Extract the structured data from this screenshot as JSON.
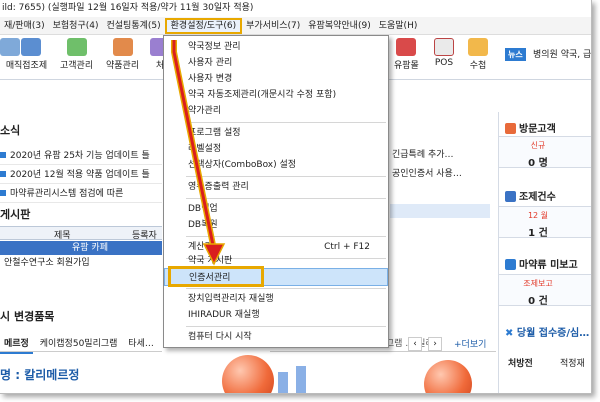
{
  "window": {
    "title": "ild: 7655) (실행파일 12월 16일자 적용/약가 11월 30일자 적용)"
  },
  "menubar": {
    "items": [
      {
        "label": "재/판매(3)"
      },
      {
        "label": "보험청구(4)"
      },
      {
        "label": "컨설팅통계(5)"
      },
      {
        "label": "환경설정/도구(6)"
      },
      {
        "label": "부가서비스(7)"
      },
      {
        "label": "유팜복약안내(9)"
      },
      {
        "label": "도움말(H)"
      }
    ]
  },
  "toolbar": {
    "left_tools": [
      "매",
      "직접조제",
      "고객관리",
      "약품관리",
      "처"
    ],
    "right_tools": [
      "유팜몰",
      "POS",
      "수첩"
    ],
    "news_badge": "뉴스",
    "news_text": "병의원 약국, 급"
  },
  "left": {
    "news_section_title": "소식",
    "news_rows": [
      "2020년 유팜 25차 기능 업데이트 틀",
      "2020년 12월 적용 약품 업데이트 틀",
      "마약류관리시스템 점검에 따른"
    ],
    "board_title": "게시판",
    "grid_headers": [
      "제목",
      "등록자"
    ],
    "grid_rows": [
      {
        "title": "유팜 카페",
        "selected": true
      },
      {
        "title": "안철수연구소 회원가입",
        "selected": false
      }
    ],
    "changes_title": "시 변경품목",
    "tabs": [
      "메르정",
      "케이캡정50밀리그램",
      "타세…"
    ],
    "drug_name": "명 : 칼리메르정"
  },
  "middle": {
    "tabs_text": "타세…50밀리그램 … 50밀리그램 … 밀리…",
    "add_link": "+더보기",
    "news_partial": [
      "긴급특례 추가…",
      "공인인증서 사용…"
    ]
  },
  "dropdown": {
    "items": [
      {
        "label": "약국정보 관리",
        "group": 1
      },
      {
        "label": "사용자 관리",
        "group": 1
      },
      {
        "label": "사용자 변경",
        "group": 1
      },
      {
        "label": "약국 자동조제관리(개문시각 수정 포함)",
        "group": 1
      },
      {
        "label": "약가관리",
        "group": 1
      },
      {
        "label": "프로그램 설정",
        "group": 2
      },
      {
        "label": "라벨설정",
        "group": 2
      },
      {
        "label": "선택상자(ComboBox) 설정",
        "group": 2
      },
      {
        "label": "영수증출력 관리",
        "group": 3
      },
      {
        "label": "DB백업",
        "group": 4
      },
      {
        "label": "DB복원",
        "group": 4
      },
      {
        "label": "계산기",
        "shortcut": "Ctrl + F12",
        "group": 5
      },
      {
        "label": "약국 게시판",
        "group": 6
      },
      {
        "label": "인증서관리",
        "group": 6,
        "highlighted": true
      },
      {
        "label": "장치입력관리자 재실행",
        "group": 7
      },
      {
        "label": "IHIRADUR 재실행",
        "group": 7
      },
      {
        "label": "컴퓨터 다시 시작",
        "group": 8
      }
    ]
  },
  "right_panel": {
    "visitors_title": "방문고객",
    "visitors_label": "신규",
    "visitors_value": "0 명",
    "dispense_title": "조제건수",
    "dispense_label": "12 월",
    "dispense_value": "1 건",
    "narcotic_title": "마약류 미보고",
    "narcotic_label": "조제보고",
    "narcotic_value": "0 건",
    "reception_title": "당월 접수증/심…",
    "tab1": "처방전",
    "tab2": "적정재"
  },
  "colors": {
    "accent_blue": "#2d7bd1",
    "callout_yellow": "#e8a800",
    "arrow_red": "#d91e1e"
  }
}
